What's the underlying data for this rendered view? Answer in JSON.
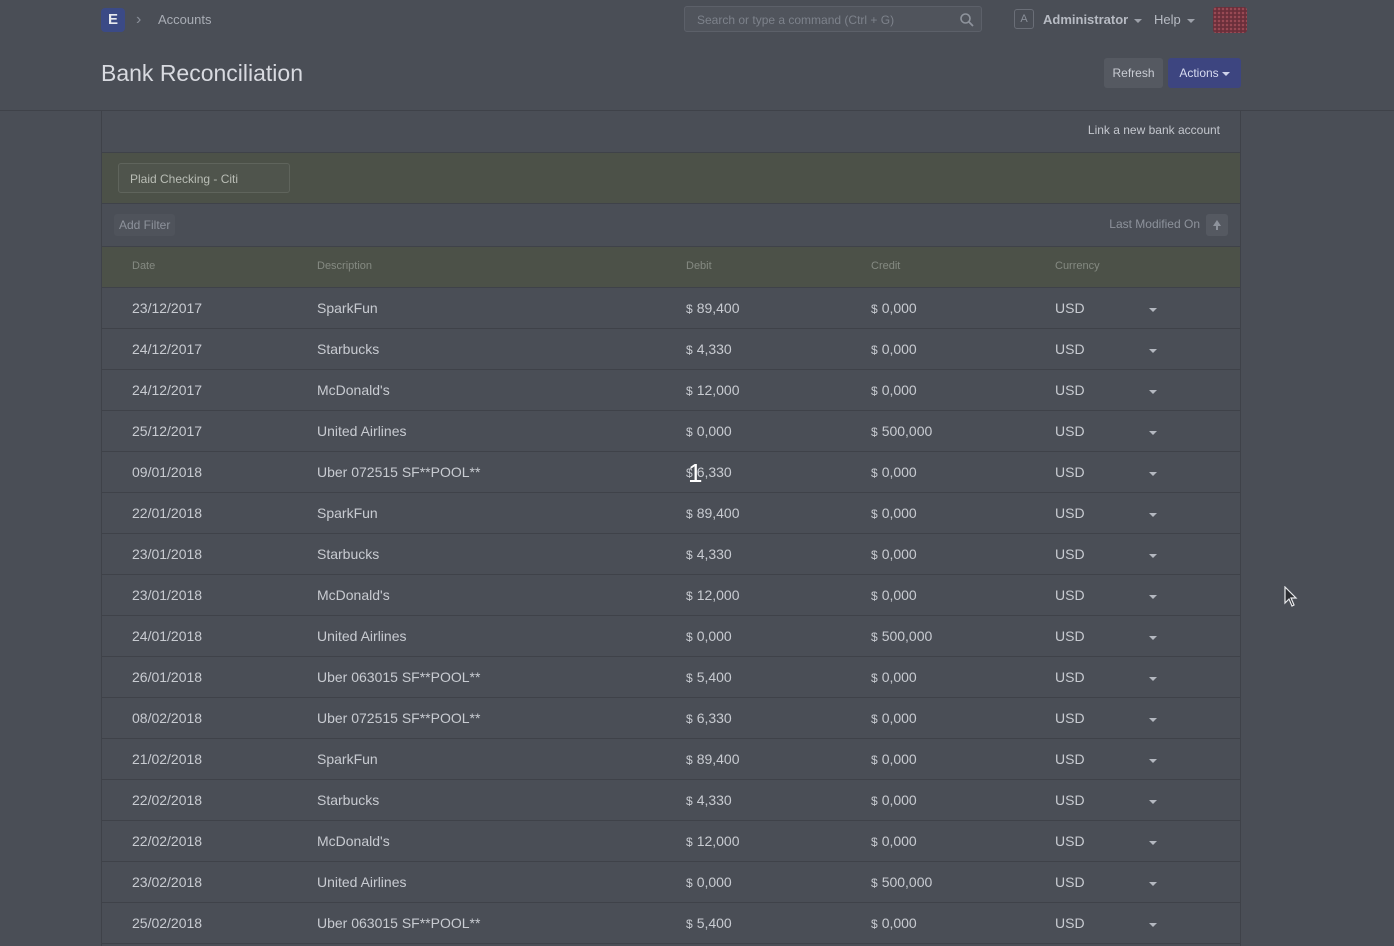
{
  "navbar": {
    "logo_letter": "E",
    "breadcrumb": "Accounts",
    "search_placeholder": "Search or type a command (Ctrl + G)",
    "user_initial": "A",
    "user_name": "Administrator",
    "help_label": "Help"
  },
  "page": {
    "title": "Bank Reconciliation",
    "refresh_label": "Refresh",
    "actions_label": "Actions"
  },
  "card": {
    "link_bank_label": "Link a new bank account",
    "account_value": "Plaid Checking - Citi",
    "add_filter_label": "Add Filter",
    "sort_label": "Last Modified On"
  },
  "table": {
    "headers": [
      "Date",
      "Description",
      "Debit",
      "Credit",
      "Currency"
    ],
    "currency_symbol": "$",
    "rows": [
      {
        "date": "23/12/2017",
        "description": "SparkFun",
        "debit": "89,400",
        "credit": "0,000",
        "currency": "USD"
      },
      {
        "date": "24/12/2017",
        "description": "Starbucks",
        "debit": "4,330",
        "credit": "0,000",
        "currency": "USD"
      },
      {
        "date": "24/12/2017",
        "description": "McDonald's",
        "debit": "12,000",
        "credit": "0,000",
        "currency": "USD"
      },
      {
        "date": "25/12/2017",
        "description": "United Airlines",
        "debit": "0,000",
        "credit": "500,000",
        "currency": "USD"
      },
      {
        "date": "09/01/2018",
        "description": "Uber 072515 SF**POOL**",
        "debit": "6,330",
        "credit": "0,000",
        "currency": "USD"
      },
      {
        "date": "22/01/2018",
        "description": "SparkFun",
        "debit": "89,400",
        "credit": "0,000",
        "currency": "USD"
      },
      {
        "date": "23/01/2018",
        "description": "Starbucks",
        "debit": "4,330",
        "credit": "0,000",
        "currency": "USD"
      },
      {
        "date": "23/01/2018",
        "description": "McDonald's",
        "debit": "12,000",
        "credit": "0,000",
        "currency": "USD"
      },
      {
        "date": "24/01/2018",
        "description": "United Airlines",
        "debit": "0,000",
        "credit": "500,000",
        "currency": "USD"
      },
      {
        "date": "26/01/2018",
        "description": "Uber 063015 SF**POOL**",
        "debit": "5,400",
        "credit": "0,000",
        "currency": "USD"
      },
      {
        "date": "08/02/2018",
        "description": "Uber 072515 SF**POOL**",
        "debit": "6,330",
        "credit": "0,000",
        "currency": "USD"
      },
      {
        "date": "21/02/2018",
        "description": "SparkFun",
        "debit": "89,400",
        "credit": "0,000",
        "currency": "USD"
      },
      {
        "date": "22/02/2018",
        "description": "Starbucks",
        "debit": "4,330",
        "credit": "0,000",
        "currency": "USD"
      },
      {
        "date": "22/02/2018",
        "description": "McDonald's",
        "debit": "12,000",
        "credit": "0,000",
        "currency": "USD"
      },
      {
        "date": "23/02/2018",
        "description": "United Airlines",
        "debit": "0,000",
        "credit": "500,000",
        "currency": "USD"
      },
      {
        "date": "25/02/2018",
        "description": "Uber 063015 SF**POOL**",
        "debit": "5,400",
        "credit": "0,000",
        "currency": "USD"
      }
    ]
  },
  "overlay": {
    "step_number": "1"
  }
}
